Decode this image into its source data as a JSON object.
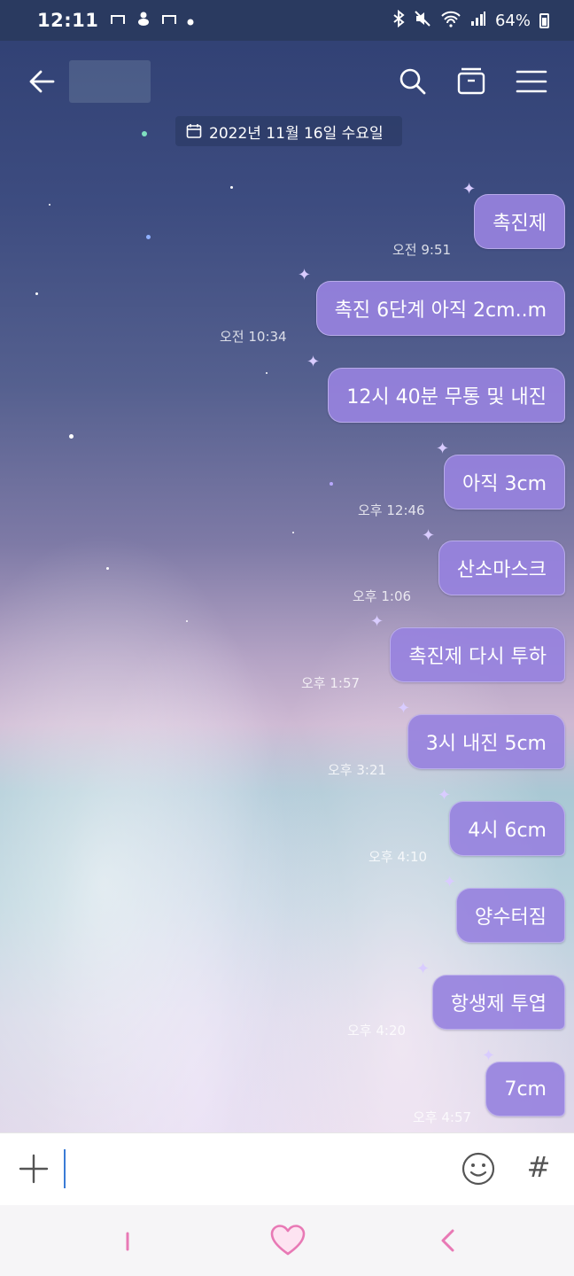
{
  "status_bar": {
    "time": "12:11",
    "battery": "64%",
    "notification_icons": [
      "chat-icon",
      "baby-icon",
      "chat-icon",
      "dot-icon"
    ],
    "right_icons": [
      "bluetooth-icon",
      "mute-icon",
      "wifi-icon",
      "signal-icon",
      "battery-icon"
    ]
  },
  "header": {
    "icons": [
      "back-arrow-icon",
      "search-icon",
      "archive-icon",
      "menu-icon"
    ]
  },
  "date_divider": "2022년 11월 16일 수요일",
  "messages": [
    {
      "text": "촉진제",
      "time": "오전 9:51"
    },
    {
      "text": "촉진 6단계 아직 2cm..m",
      "time": "오전 10:34"
    },
    {
      "text": "12시 40분 무통 및 내진",
      "time": ""
    },
    {
      "text": "아직 3cm",
      "time": "오후 12:46"
    },
    {
      "text": "산소마스크",
      "time": "오후 1:06"
    },
    {
      "text": "촉진제 다시 투하",
      "time": "오후 1:57"
    },
    {
      "text": "3시 내진 5cm",
      "time": "오후 3:21"
    },
    {
      "text": "4시 6cm",
      "time": "오후 4:10"
    },
    {
      "text": "양수터짐",
      "time": ""
    },
    {
      "text": "항생제 투엽",
      "time": "오후 4:20"
    },
    {
      "text": "7cm",
      "time": "오후 4:57"
    }
  ],
  "input_bar": {
    "hash_label": "#",
    "icons": [
      "plus-icon",
      "emoji-icon",
      "hash-icon"
    ]
  },
  "nav_bar": {
    "icons": [
      "recent-apps-icon",
      "heart-home-icon",
      "back-icon"
    ]
  },
  "colors": {
    "bubble": "#9782de",
    "status_bar": "#2a3a60",
    "accent_pink": "#e879b5",
    "cursor": "#3a7bd5"
  }
}
